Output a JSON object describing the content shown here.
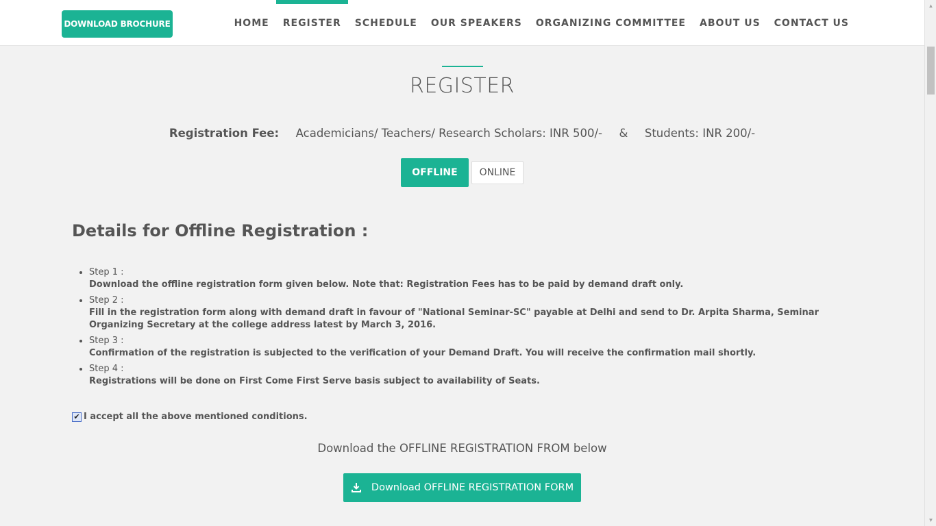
{
  "header": {
    "brochure_label": "DOWNLOAD BROCHURE",
    "nav": [
      {
        "label": "HOME",
        "active": false
      },
      {
        "label": "REGISTER",
        "active": true
      },
      {
        "label": "SCHEDULE",
        "active": false
      },
      {
        "label": "OUR SPEAKERS",
        "active": false
      },
      {
        "label": "ORGANIZING COMMITTEE",
        "active": false
      },
      {
        "label": "ABOUT US",
        "active": false
      },
      {
        "label": "CONTACT US",
        "active": false
      }
    ]
  },
  "main": {
    "title": "REGISTER",
    "fee": {
      "label": "Registration Fee:",
      "academicians": "Academicians/ Teachers/ Research Scholars:  INR 500/-",
      "separator": "&",
      "students": "Students:  INR 200/-"
    },
    "tabs": [
      {
        "label": "OFFLINE",
        "active": true
      },
      {
        "label": "ONLINE",
        "active": false
      }
    ],
    "details_heading": "Details for Offline Registration :",
    "steps": [
      {
        "label": "Step 1 :",
        "text": "Download the offline registration form given below. Note that: Registration Fees has to be paid by demand draft only."
      },
      {
        "label": "Step 2 :",
        "text": "Fill in the registration form along with demand draft in favour of \"National Seminar-SC\" payable at Delhi and send to Dr. Arpita Sharma, Seminar Organizing Secretary at the college address latest by March 3, 2016."
      },
      {
        "label": "Step 3 :",
        "text": "Confirmation of the registration is subjected to the verification of your Demand Draft. You will receive the confirmation mail shortly."
      },
      {
        "label": "Step 4 :",
        "text": "Registrations will be done on First Come First Serve basis subject to availability of Seats."
      }
    ],
    "accept_label": "I accept all the above mentioned conditions.",
    "accept_checked": true,
    "download_caption": "Download the OFFLINE REGISTRATION FROM below",
    "download_button": "Download OFFLINE REGISTRATION FORM"
  },
  "colors": {
    "accent": "#1bb394",
    "text": "#555555",
    "background": "#f2f2f2"
  },
  "icons": {
    "download": "download-icon",
    "checkbox": "check-icon"
  }
}
